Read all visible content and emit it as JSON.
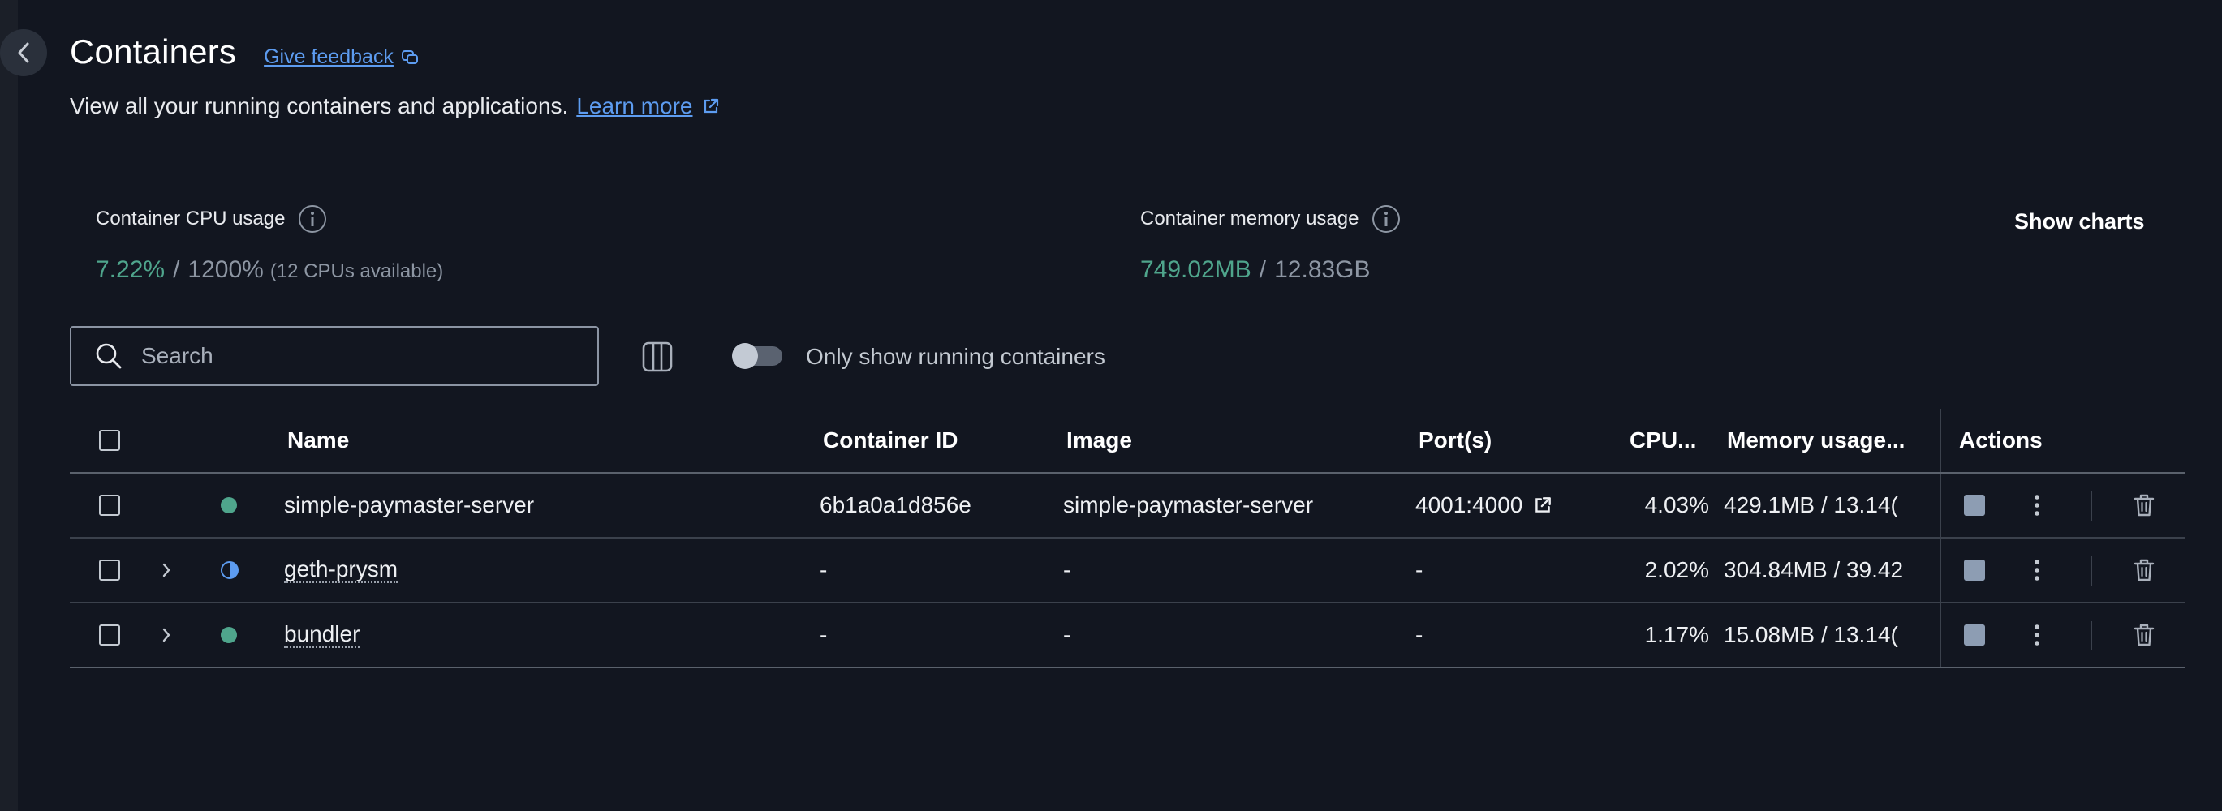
{
  "header": {
    "title": "Containers",
    "feedback_label": "Give feedback",
    "subtitle": "View all your running containers and applications.",
    "learn_more_label": "Learn more"
  },
  "stats": {
    "cpu": {
      "label": "Container CPU usage",
      "used": "7.22%",
      "separator": "/",
      "total": "1200%",
      "note": "(12 CPUs available)"
    },
    "memory": {
      "label": "Container memory usage",
      "used": "749.02MB",
      "separator": "/",
      "total": "12.83GB"
    },
    "show_charts_label": "Show charts"
  },
  "toolbar": {
    "search_placeholder": "Search",
    "running_toggle_label": "Only show running containers",
    "running_toggle_on": false
  },
  "table": {
    "columns": {
      "name": "Name",
      "container_id": "Container ID",
      "image": "Image",
      "ports": "Port(s)",
      "cpu": "CPU...",
      "memory": "Memory usage...",
      "actions": "Actions"
    },
    "rows": [
      {
        "name": "simple-paymaster-server",
        "container_id": "6b1a0a1d856e",
        "image": "simple-paymaster-server",
        "ports": "4001:4000",
        "cpu": "4.03%",
        "memory": "429.1MB / 13.14(",
        "status": "running",
        "expandable": false
      },
      {
        "name": "geth-prysm",
        "container_id": "-",
        "image": "-",
        "ports": "-",
        "cpu": "2.02%",
        "memory": "304.84MB / 39.42",
        "status": "partial",
        "expandable": true
      },
      {
        "name": "bundler",
        "container_id": "-",
        "image": "-",
        "ports": "-",
        "cpu": "1.17%",
        "memory": "15.08MB / 13.14(",
        "status": "running",
        "expandable": true
      }
    ]
  },
  "colors": {
    "background": "#121620",
    "accent_link": "#5d9cf0",
    "running_green": "#4fa58c",
    "muted_text": "#8d96a3"
  }
}
